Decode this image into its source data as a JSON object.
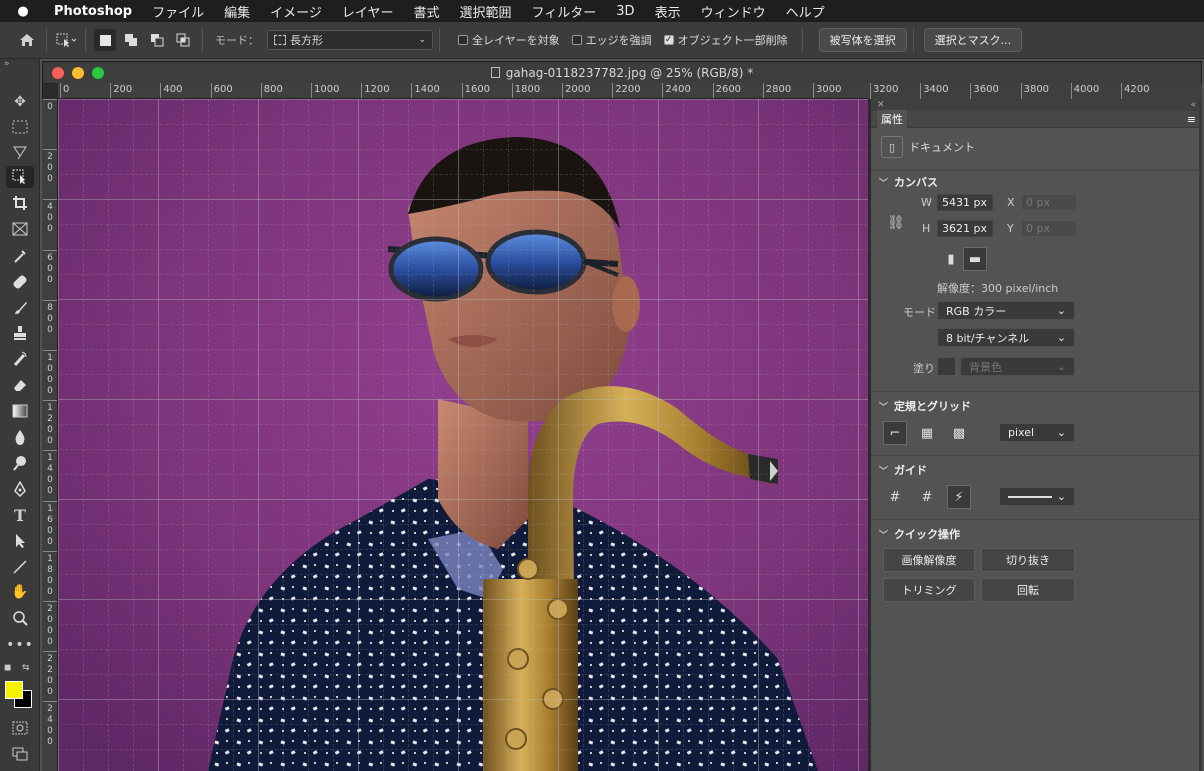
{
  "menubar": {
    "apple": "",
    "items": [
      "Photoshop",
      "ファイル",
      "編集",
      "イメージ",
      "レイヤー",
      "書式",
      "選択範囲",
      "フィルター",
      "3D",
      "表示",
      "ウィンドウ",
      "ヘルプ"
    ]
  },
  "options": {
    "mode_label": "モード：",
    "mode_value": "長方形",
    "sample_all_layers": "全レイヤーを対象",
    "enhance_edge": "エッジを強調",
    "object_subtract": "オブジェクト一部削除",
    "select_subject": "被写体を選択",
    "select_and_mask": "選択とマスク..."
  },
  "document": {
    "title": "gahag-0118237782.jpg @ 25% (RGB/8) *"
  },
  "ruler": {
    "h_ticks": [
      "0",
      "200",
      "400",
      "600",
      "800",
      "1000",
      "1200",
      "1400",
      "1600",
      "1800",
      "2000",
      "2200",
      "2400",
      "2600",
      "2800",
      "3000"
    ],
    "h_ticks_right": [
      "3200",
      "3400",
      "3600",
      "3800",
      "4000",
      "4200"
    ],
    "v_ticks": [
      "0",
      "200",
      "400",
      "600",
      "800",
      "1000",
      "1200",
      "1400",
      "1600",
      "1800",
      "2000",
      "2200",
      "2400"
    ]
  },
  "panel": {
    "tab": "属性",
    "document_label": "ドキュメント",
    "canvas_section": "カンバス",
    "w_label": "W",
    "w_value": "5431 px",
    "h_label": "H",
    "h_value": "3621 px",
    "x_label": "X",
    "x_value": "0 px",
    "y_label": "Y",
    "y_value": "0 px",
    "resolution": "解像度：300 pixel/inch",
    "mode_label": "モード",
    "mode_value": "RGB カラー",
    "bit_value": "8 bit/チャンネル",
    "fill_label": "塗り",
    "fill_value": "背景色",
    "rulers_section": "定規とグリッド",
    "unit_value": "pixel",
    "guides_section": "ガイド",
    "quick_section": "クイック操作",
    "btn_image_size": "画像解像度",
    "btn_crop": "切り抜き",
    "btn_trim": "トリミング",
    "btn_rotate": "回転"
  },
  "colors": {
    "foreground": "#f7f200",
    "background": "#000000",
    "canvas_bg": "#7a3479"
  }
}
